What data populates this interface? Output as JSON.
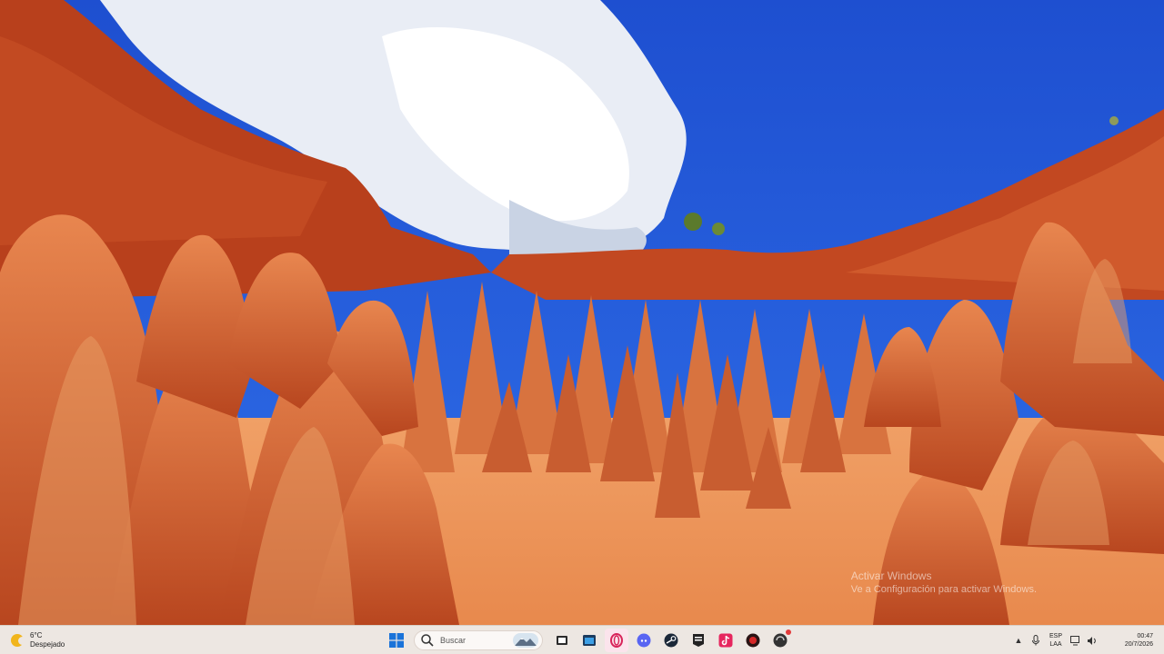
{
  "wallpaper": {
    "description_icon": "landscape-wallpaper"
  },
  "watermark": {
    "title": "Activar Windows",
    "subtitle": "Ve a Configuración para activar Windows."
  },
  "taskbar": {
    "weather": {
      "temp": "6°C",
      "condition": "Despejado",
      "icon": "partly-sunny-icon"
    },
    "search": {
      "placeholder": "Buscar"
    },
    "apps": [
      {
        "name": "start-button",
        "icon": "windows-logo-icon"
      },
      {
        "name": "search-box",
        "icon": "search-icon"
      },
      {
        "name": "task-view",
        "icon": "task-view-icon"
      },
      {
        "name": "file-explorer",
        "icon": "folder-icon"
      },
      {
        "name": "opera-gx",
        "icon": "opera-icon"
      },
      {
        "name": "discord",
        "icon": "discord-icon"
      },
      {
        "name": "steam",
        "icon": "steam-icon"
      },
      {
        "name": "epic-games",
        "icon": "epic-games-icon"
      },
      {
        "name": "tiktok",
        "icon": "tiktok-icon"
      },
      {
        "name": "app-red",
        "icon": "red-circle-app-icon"
      },
      {
        "name": "app-dark",
        "icon": "dark-app-icon"
      }
    ],
    "tray": {
      "language": "ESP",
      "layout": "LAA",
      "time": "00:47",
      "date": "20/7/2026"
    }
  }
}
